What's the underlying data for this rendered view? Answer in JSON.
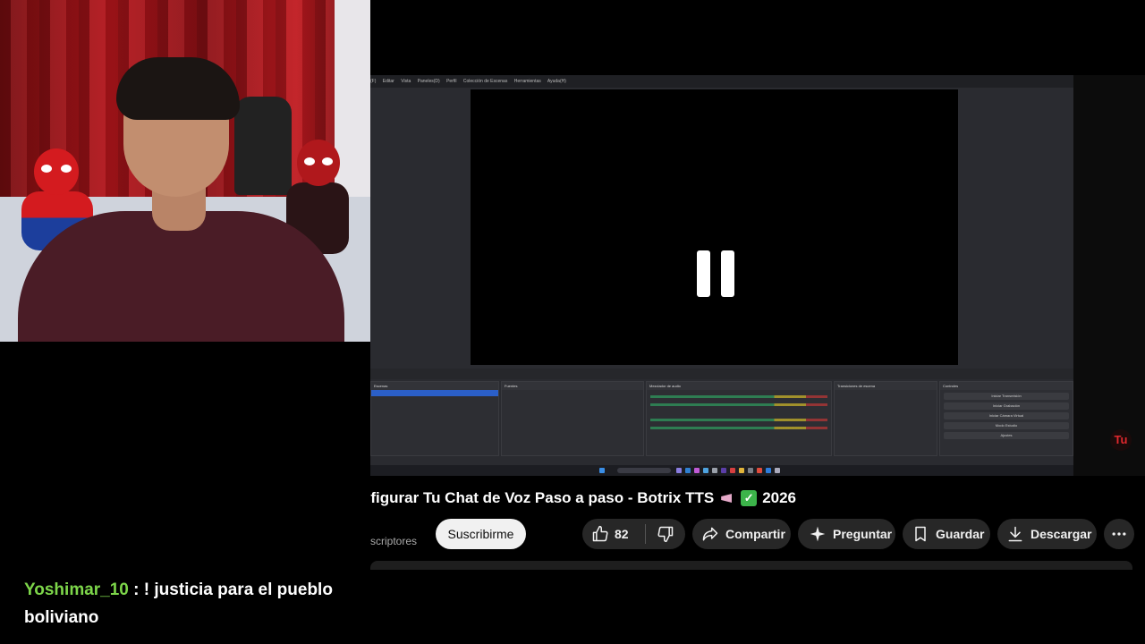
{
  "video": {
    "title": "nfigurar Tu Chat de Voz Paso a paso - Botrix TTS",
    "title_year": "2026",
    "subscribers_fragment": "scriptores"
  },
  "actions": {
    "subscribe_label": "Suscribirme",
    "like_count": "82",
    "share_label": "Compartir",
    "ask_label": "Preguntar",
    "save_label": "Guardar",
    "download_label": "Descargar"
  },
  "chat": {
    "username": "Yoshimar_10",
    "separator": " : ",
    "message": "! justicia para el pueblo boliviano"
  },
  "overlay": {
    "channel_badge": "Tu"
  },
  "obs": {
    "menu": [
      "(F)",
      "Editar",
      "Vista",
      "Paneles(D)",
      "Perfil",
      "Colección de Escenas",
      "Herramientas",
      "Ayuda(H)"
    ],
    "docks": [
      "Escenas",
      "Fuentes",
      "Mezclador de audio",
      "Transiciones de escena",
      "Controles"
    ],
    "controls": [
      "Iniciar Transmisión",
      "Iniciar Grabación",
      "Iniciar Cámara Virtual",
      "Modo Estudio",
      "Ajustes",
      "Salir"
    ]
  },
  "colors": {
    "chat_username": "#7dd64a",
    "youtube_pill_bg": "#272727",
    "subscribe_bg": "#f1f1f1"
  }
}
